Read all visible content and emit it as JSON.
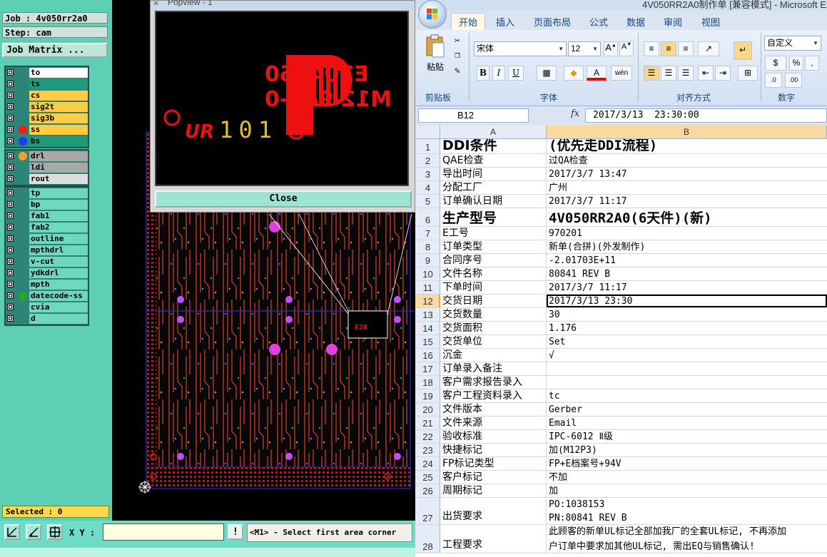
{
  "genesis": {
    "job_field": "Job : 4v050rr2a0",
    "step_field": "Step: cam",
    "job_matrix_label": "Job Matrix ...",
    "layer_groups": [
      [
        {
          "name": "to",
          "bg": "#ffffff",
          "dot": ""
        },
        {
          "name": "ts",
          "bg": "#1f9a7a",
          "dot": ""
        },
        {
          "name": "cs",
          "bg": "#ffcc44",
          "dot": ""
        },
        {
          "name": "sig2t",
          "bg": "#ffcc44",
          "dot": ""
        },
        {
          "name": "sig3b",
          "bg": "#ffcc44",
          "dot": ""
        },
        {
          "name": "ss",
          "bg": "#ffcc44",
          "dot": "#ff1a1a"
        },
        {
          "name": "bs",
          "bg": "#1f9a7a",
          "dot": "#1a3cff"
        }
      ],
      [
        {
          "name": "drl",
          "bg": "#a9a9a9",
          "dot": "#ff9933"
        },
        {
          "name": "ldi",
          "bg": "#a9a9a9",
          "dot": ""
        },
        {
          "name": "rout",
          "bg": "#dddddd",
          "dot": ""
        }
      ],
      [
        {
          "name": "tp",
          "bg": "#6fd6c0",
          "dot": ""
        },
        {
          "name": "bp",
          "bg": "#6fd6c0",
          "dot": ""
        },
        {
          "name": "fab1",
          "bg": "#6fd6c0",
          "dot": ""
        },
        {
          "name": "fab2",
          "bg": "#6fd6c0",
          "dot": ""
        },
        {
          "name": "outline",
          "bg": "#6fd6c0",
          "dot": ""
        },
        {
          "name": "mpthdrl",
          "bg": "#6fd6c0",
          "dot": ""
        },
        {
          "name": "v-cut",
          "bg": "#6fd6c0",
          "dot": ""
        },
        {
          "name": "ydkdrl",
          "bg": "#6fd6c0",
          "dot": ""
        },
        {
          "name": "mpth",
          "bg": "#6fd6c0",
          "dot": ""
        },
        {
          "name": "datecode-ss",
          "bg": "#6fd6c0",
          "dot": "#22aa22"
        },
        {
          "name": "cvia",
          "bg": "#6fd6c0",
          "dot": ""
        },
        {
          "name": "d",
          "bg": "#6fd6c0",
          "dot": ""
        }
      ]
    ],
    "selected_label": "Selected : 0",
    "xy_label": "X Y :",
    "xy_value": "",
    "alert_label": "!",
    "status_message": "<M1> - Select first area corner"
  },
  "popview": {
    "title": "Popview - 1",
    "board_text_line1": "E204460",
    "board_text_line2": "M12 94V-0",
    "board_text_line3": "101",
    "close_label": "Close"
  },
  "excel": {
    "title": "4V050RR2A0制作单 [兼容模式] - Microsoft Excel",
    "tabs": [
      "开始",
      "插入",
      "页面布局",
      "公式",
      "数据",
      "审阅",
      "视图"
    ],
    "active_tab": "开始",
    "groups": {
      "clipboard": "剪贴板",
      "paste": "粘贴",
      "font": "字体",
      "alignment": "对齐方式",
      "number": "数字"
    },
    "font_name": "宋体",
    "font_size": "12",
    "number_format": "自定义",
    "name_box": "B12",
    "formula_value": "2017/3/13  23:30:00",
    "columns": [
      "A",
      "B"
    ],
    "rows": [
      {
        "n": "1",
        "a": "DDI条件",
        "b": "(优先走DDI流程)",
        "big": true,
        "h": 21
      },
      {
        "n": "2",
        "a": "QAE检查",
        "b": "过QA检查",
        "h": 19
      },
      {
        "n": "3",
        "a": "导出时间",
        "b": "2017/3/7 13:47",
        "h": 19
      },
      {
        "n": "4",
        "a": "分配工厂",
        "b": "广州",
        "h": 19
      },
      {
        "n": "5",
        "a": "订单确认日期",
        "b": "2017/3/7 11:17",
        "h": 19
      },
      {
        "n": "6",
        "a": "生产型号",
        "b": "4V050RR2A0(6天件)(新)",
        "big": true,
        "h": 26
      },
      {
        "n": "7",
        "a": "E工号",
        "b": "970201",
        "h": 19
      },
      {
        "n": "8",
        "a": "订单类型",
        "b": "新单(合拼)(外发制作)",
        "h": 19
      },
      {
        "n": "9",
        "a": "合同序号",
        "b": "-2.01703E+11",
        "h": 19
      },
      {
        "n": "10",
        "a": "文件名称",
        "b": "80841 REV B",
        "h": 19
      },
      {
        "n": "11",
        "a": "下单时间",
        "b": "2017/3/7 11:17",
        "h": 19
      },
      {
        "n": "12",
        "a": "交货日期",
        "b": "2017/3/13 23:30",
        "h": 19,
        "selected": true
      },
      {
        "n": "13",
        "a": "交货数量",
        "b": "30",
        "h": 19
      },
      {
        "n": "14",
        "a": "交货面积",
        "b": "1.176",
        "h": 19
      },
      {
        "n": "15",
        "a": "交货单位",
        "b": "Set",
        "h": 19
      },
      {
        "n": "16",
        "a": "沉金",
        "b": "√",
        "h": 19
      },
      {
        "n": "17",
        "a": "订单录入备注",
        "b": "",
        "h": 19
      },
      {
        "n": "18",
        "a": "客户需求报告录入",
        "b": "",
        "h": 19
      },
      {
        "n": "19",
        "a": "客户工程资料录入",
        "b": "tc",
        "h": 19
      },
      {
        "n": "20",
        "a": "文件版本",
        "b": "Gerber",
        "h": 19
      },
      {
        "n": "21",
        "a": "文件来源",
        "b": "Email",
        "h": 19
      },
      {
        "n": "22",
        "a": "验收标准",
        "b": "IPC-6012 Ⅱ级",
        "h": 19
      },
      {
        "n": "23",
        "a": "快捷标记",
        "b": "加(M12P3)",
        "h": 19
      },
      {
        "n": "24",
        "a": "FP标记类型",
        "b": "FP+E档案号+94V",
        "h": 19
      },
      {
        "n": "25",
        "a": "客户标记",
        "b": "不加",
        "h": 19
      },
      {
        "n": "26",
        "a": "周期标记",
        "b": "加",
        "h": 19
      },
      {
        "n": "27",
        "a": "出货要求",
        "b": "PO:1038153",
        "b2": "PN:80841 REV B",
        "h": 38
      },
      {
        "n": "28",
        "a": "工程要求",
        "b": "此顾客的新单UL标记全部加我厂的全套UL标记, 不再添加",
        "b2": "户订单中要求加其他UL标记, 需出EQ与销售确认!",
        "h": 40
      }
    ]
  }
}
